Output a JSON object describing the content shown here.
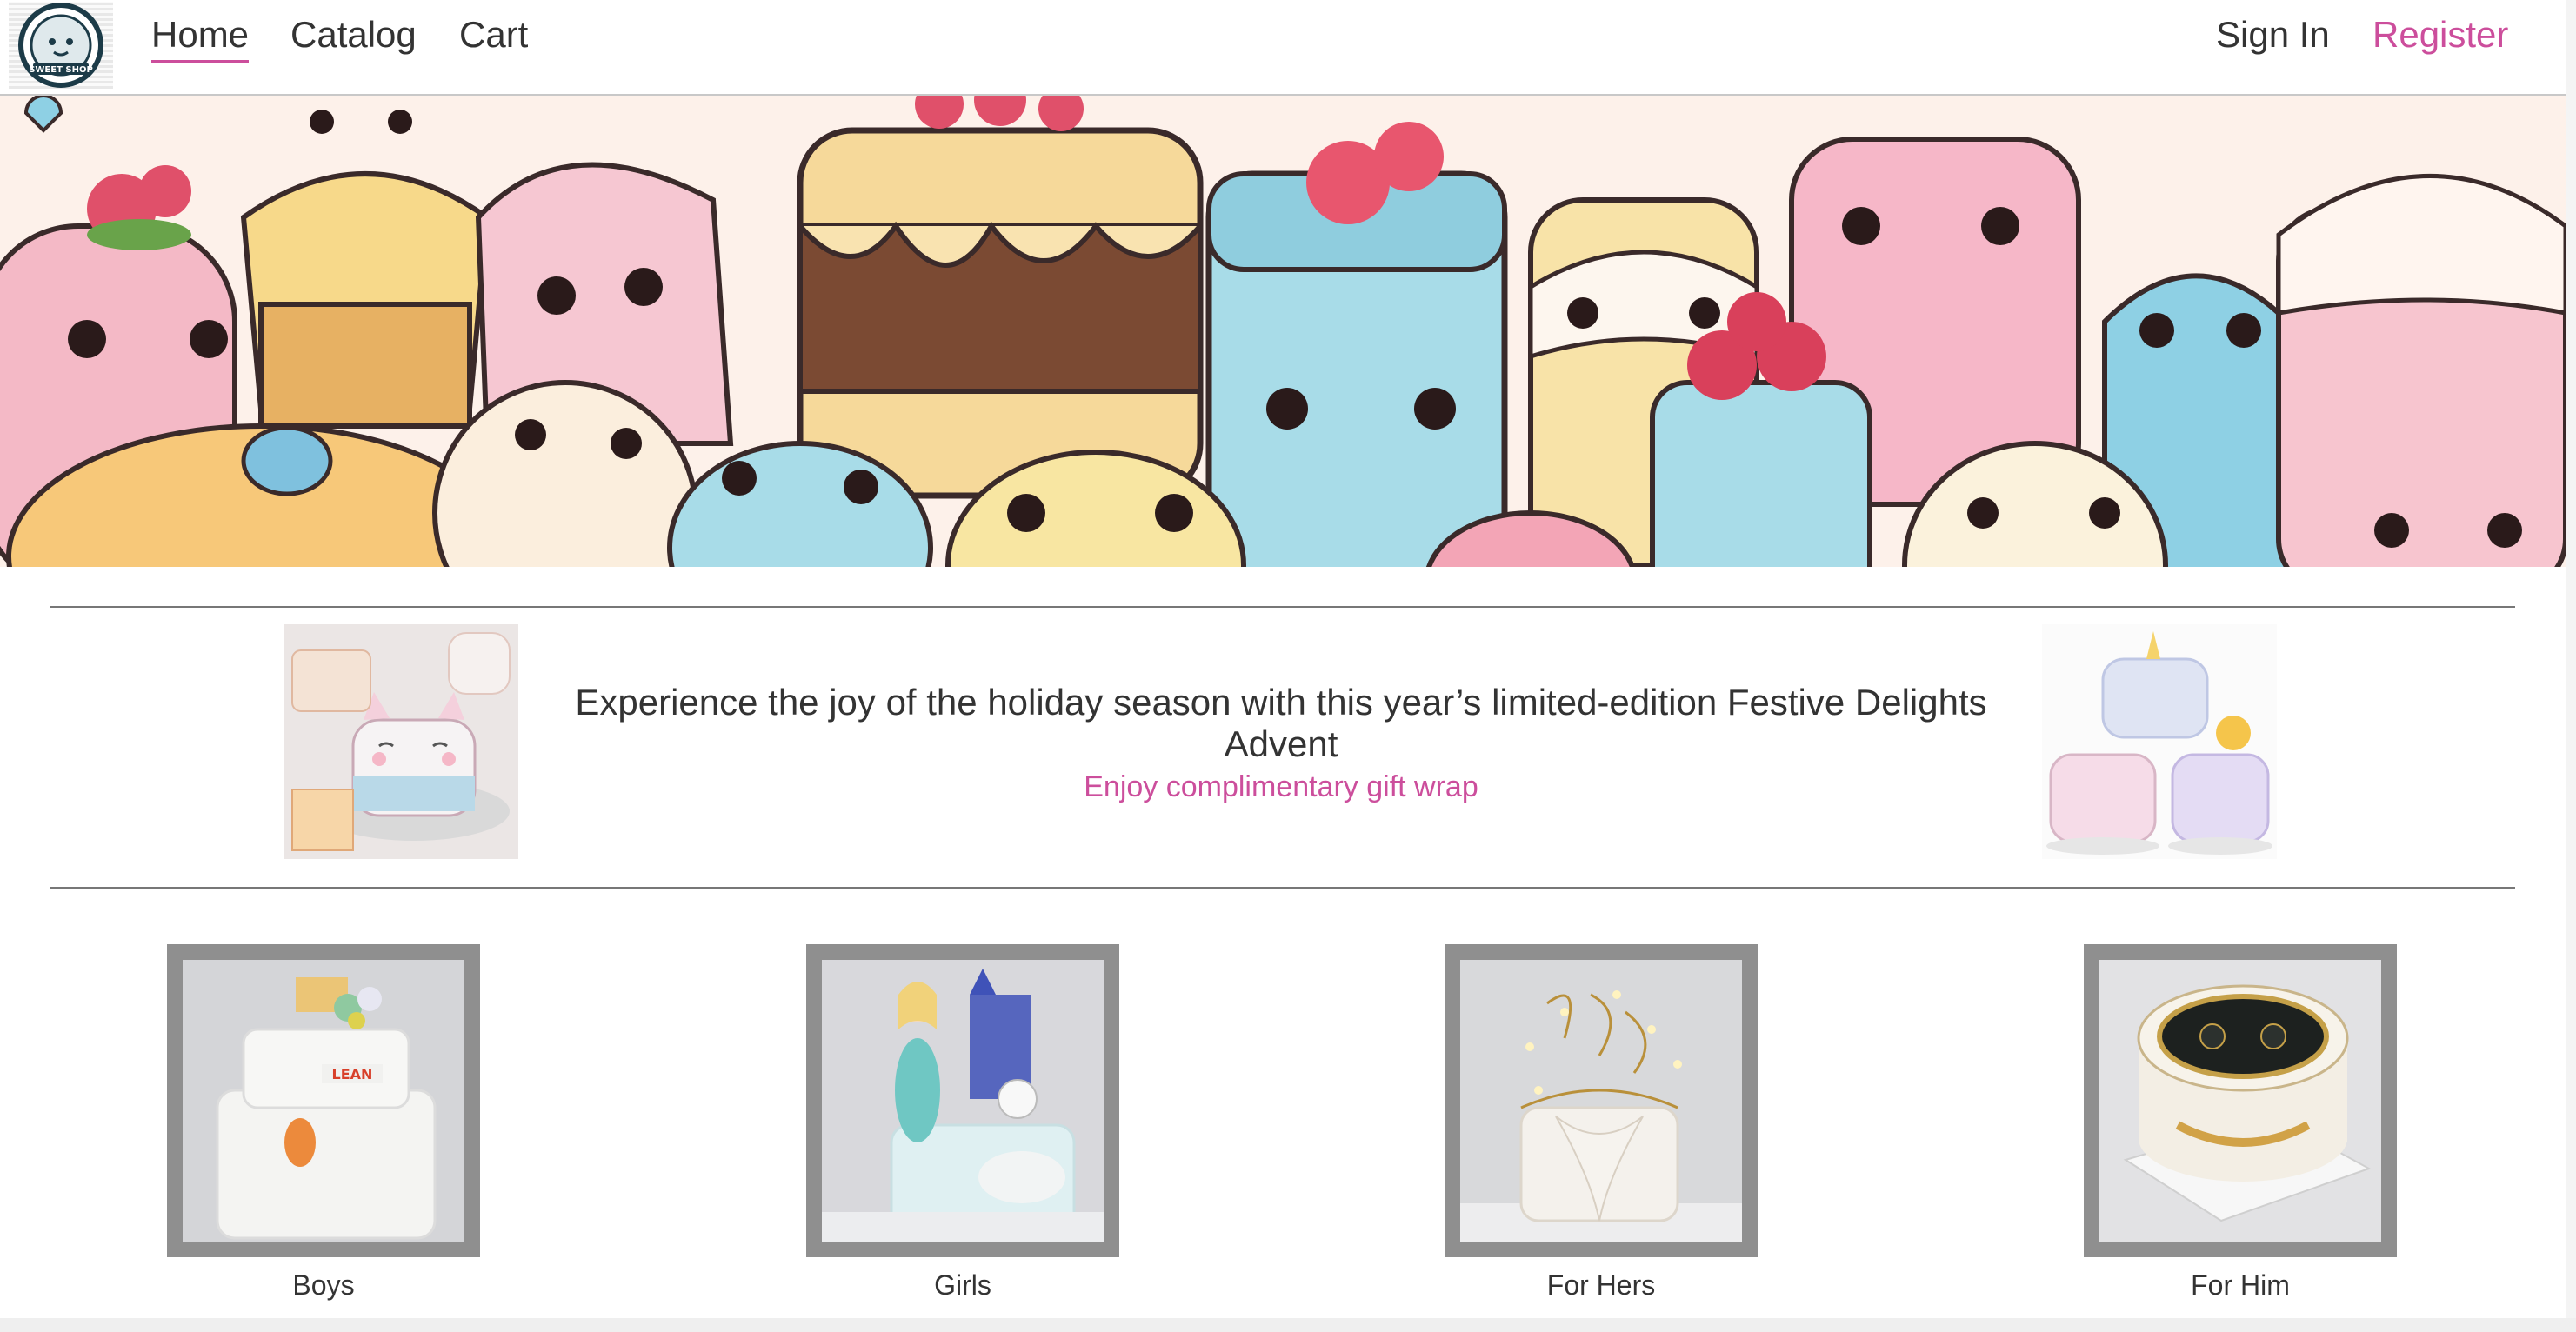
{
  "nav": {
    "logo_text": "SWEET SHOP",
    "links": [
      "Home",
      "Catalog",
      "Cart"
    ],
    "active": "Home",
    "sign_in": "Sign In",
    "register": "Register"
  },
  "promo": {
    "headline": "Experience the joy of the holiday season with this year’s limited-edition Festive Delights Advent",
    "subline": "Enjoy complimentary gift wrap"
  },
  "categories": [
    {
      "label": "Boys"
    },
    {
      "label": "Girls"
    },
    {
      "label": "For Hers"
    },
    {
      "label": "For Him"
    }
  ],
  "colors": {
    "accent": "#cc4e9c",
    "text": "#333333",
    "frame": "#8f8f8f"
  }
}
